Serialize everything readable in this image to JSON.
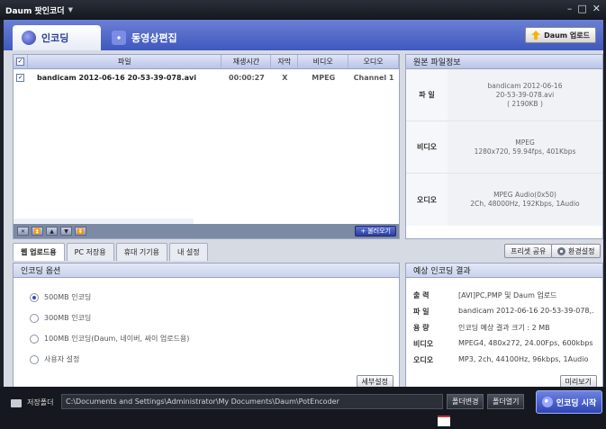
{
  "window": {
    "title": "Daum 팟인코더"
  },
  "main_tabs": [
    {
      "label": "인코딩",
      "icon": "encode-icon",
      "active": true
    },
    {
      "label": "동영상편집",
      "icon": "edit-sparkle-icon",
      "active": false
    }
  ],
  "daum_upload_label": "Daum 업로드",
  "file_list": {
    "columns": [
      "파일",
      "재생시간",
      "자막",
      "비디오",
      "오디오"
    ],
    "rows": [
      {
        "checked": true,
        "file": "bandicam 2012-06-16 20-53-39-078.avi",
        "duration": "00:00:27",
        "subtitle": "X",
        "video": "MPEG",
        "audio": "Channel 1"
      }
    ],
    "add_label": "불러오기"
  },
  "source_info": {
    "title": "원본 파일정보",
    "file_label": "파 일",
    "file_lines": [
      "bandicam 2012-06-16",
      "20-53-39-078.avi",
      "( 2190KB )"
    ],
    "video_label": "비디오",
    "video_lines": [
      "MPEG",
      "1280x720, 59.94fps, 401Kbps"
    ],
    "audio_label": "오디오",
    "audio_lines": [
      "MPEG Audio(0x50)",
      "2Ch, 48000Hz, 192Kbps, 1Audio"
    ]
  },
  "sub_tabs": [
    "웹 업로드용",
    "PC 저장용",
    "휴대 기기용",
    "내 설정"
  ],
  "share_label": "프리셋 공유",
  "env_label": "환경설정",
  "options": {
    "title": "인코딩 옵션",
    "items": [
      "500MB 인코딩",
      "300MB 인코딩",
      "100MB 인코딩(Daum, 네이버, 싸이 업로드용)",
      "사용자 설정"
    ],
    "selected": 0,
    "detail_label": "세부설정"
  },
  "result": {
    "title": "예상 인코딩 결과",
    "rows": [
      {
        "k": "출 력",
        "v": "[AVI]PC,PMP 및 Daum 업로드"
      },
      {
        "k": "파 일",
        "v": "bandicam 2012-06-16 20-53-39-078,..."
      },
      {
        "k": "용 량",
        "v": "인코딩 예상 결과 크기 : 2 MB"
      },
      {
        "k": "비디오",
        "v": "MPEG4, 480x272, 24.00Fps, 600kbps"
      },
      {
        "k": "오디오",
        "v": "MP3, 2ch, 44100Hz, 96kbps, 1Audio"
      }
    ],
    "preview_label": "미리보기"
  },
  "bottom": {
    "folder_label": "저장폴더",
    "path": "C:\\Documents and Settings\\Administrator\\My Documents\\Daum\\PotEncoder",
    "change_label": "폴더변경",
    "open_label": "폴더열기",
    "start_label": "인코딩 시작"
  }
}
